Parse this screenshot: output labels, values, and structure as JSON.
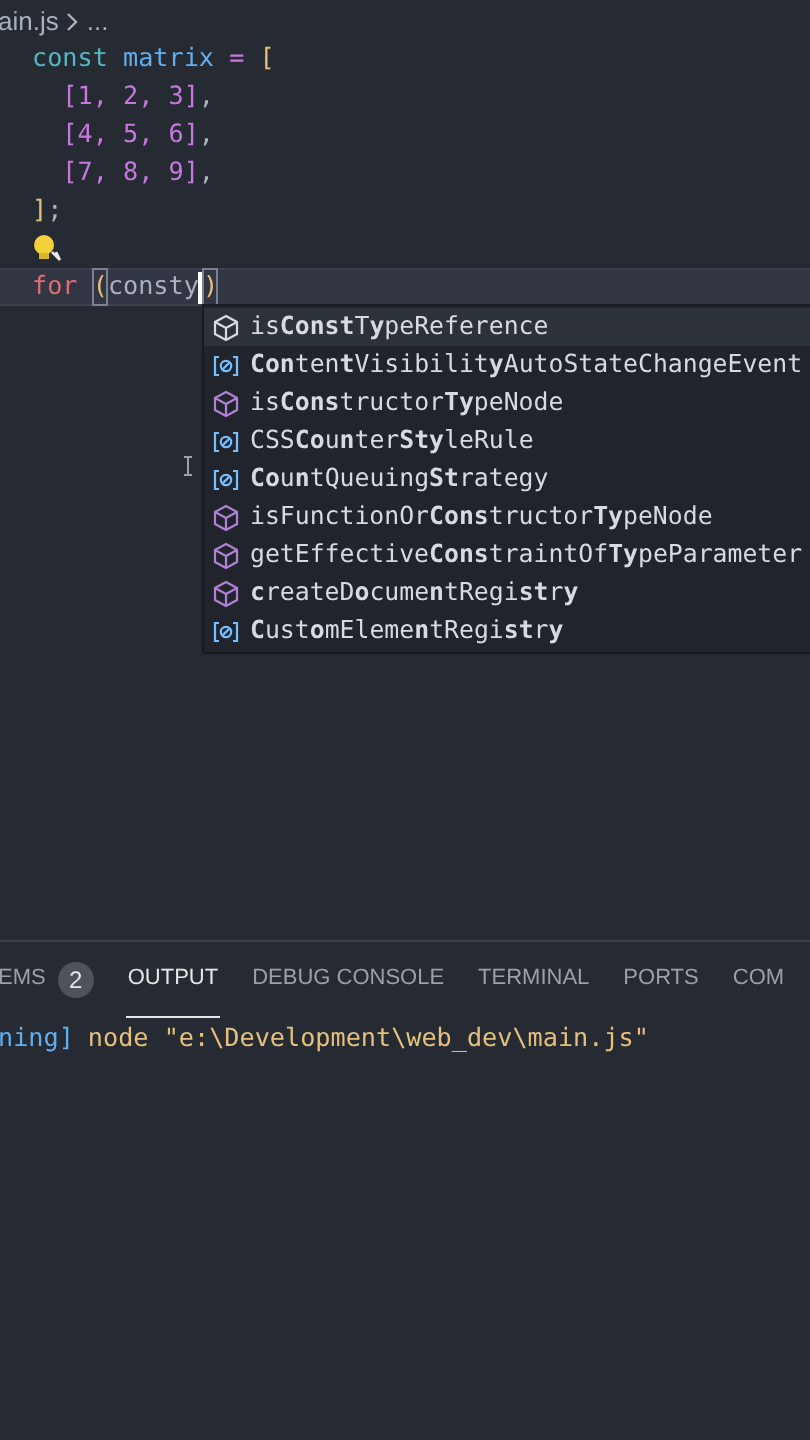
{
  "breadcrumb": {
    "file": "ain.js",
    "rest": "..."
  },
  "code_lines": [
    {
      "current": false,
      "tokens": [
        {
          "text": "const",
          "kind": "keyword"
        },
        {
          "text": " matrix",
          "kind": "name"
        },
        {
          "text": " =",
          "kind": "operator"
        },
        {
          "text": " [",
          "kind": "bracket"
        }
      ]
    },
    {
      "current": false,
      "tokens": [
        {
          "text": "  [1, 2, 3]",
          "kind": "array"
        },
        {
          "text": ",",
          "kind": "punct"
        }
      ]
    },
    {
      "current": false,
      "tokens": [
        {
          "text": "  [4, 5, 6]",
          "kind": "array"
        },
        {
          "text": ",",
          "kind": "punct"
        }
      ]
    },
    {
      "current": false,
      "tokens": [
        {
          "text": "  [7, 8, 9]",
          "kind": "array"
        },
        {
          "text": ",",
          "kind": "punct"
        }
      ]
    },
    {
      "current": false,
      "tokens": [
        {
          "text": "]",
          "kind": "bracket"
        },
        {
          "text": ";",
          "kind": "punct"
        }
      ]
    },
    {
      "current": false,
      "lightbulb": true
    },
    {
      "current": true,
      "tokens": [
        {
          "text": "for ",
          "kind": "control"
        },
        {
          "text": "(",
          "kind": "bracket"
        },
        {
          "text": "consty",
          "kind": "plain"
        },
        {
          "text": ")",
          "kind": "bracket"
        }
      ]
    }
  ],
  "suggestions": [
    {
      "kind": "method",
      "label": "is**Const**T**y**peReference",
      "selected": true
    },
    {
      "kind": "variable",
      "label": "**Con**ten**t**Visibilit**y**AutoStateChangeEvent",
      "selected": false
    },
    {
      "kind": "method",
      "label": "is**Cons**tructor**Ty**peNode",
      "selected": false
    },
    {
      "kind": "variable",
      "label": "CSS**Co**u**n**ter**Sty**leRule",
      "selected": false
    },
    {
      "kind": "variable",
      "label": "**Co**u**n**tQueuing**St**rategy",
      "selected": false
    },
    {
      "kind": "method",
      "label": "isFunctionOr**Cons**tructor**Ty**peNode",
      "selected": false
    },
    {
      "kind": "method",
      "label": "getEffective**Cons**traintOf**Ty**peParameter",
      "selected": false
    },
    {
      "kind": "method",
      "label": "**c**reateD**o**cume**n**tRegi**st**r**y**",
      "selected": false
    },
    {
      "kind": "variable",
      "label": "**C**ust**o**mEleme**n**tRegi**st**r**y**",
      "selected": false
    }
  ],
  "panel": {
    "tabs": [
      {
        "label": "EMS",
        "badge": "2",
        "selected": false
      },
      {
        "label": "OUTPUT",
        "selected": true
      },
      {
        "label": "DEBUG CONSOLE",
        "selected": false
      },
      {
        "label": "TERMINAL",
        "selected": false
      },
      {
        "label": "PORTS",
        "selected": false
      },
      {
        "label": "COM",
        "selected": false
      }
    ],
    "output": [
      {
        "prefix": "ning]",
        "text": "node \"e:\\Development\\web_dev\\main.js\""
      }
    ]
  }
}
